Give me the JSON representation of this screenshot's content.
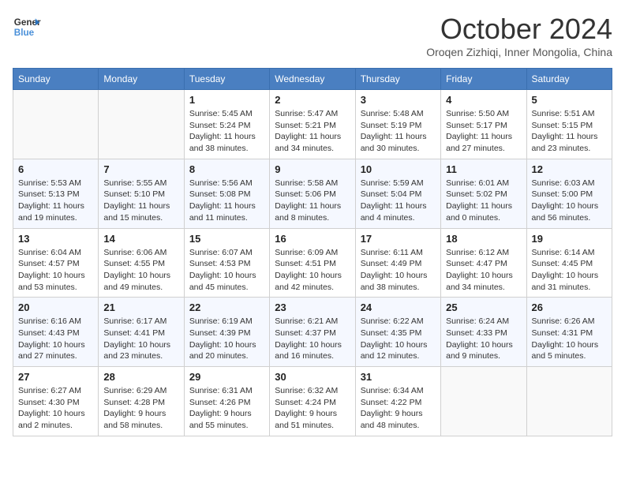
{
  "header": {
    "logo_line1": "General",
    "logo_line2": "Blue",
    "month_title": "October 2024",
    "location": "Oroqen Zizhiqi, Inner Mongolia, China"
  },
  "weekdays": [
    "Sunday",
    "Monday",
    "Tuesday",
    "Wednesday",
    "Thursday",
    "Friday",
    "Saturday"
  ],
  "weeks": [
    [
      {
        "day": "",
        "sunrise": "",
        "sunset": "",
        "daylight": ""
      },
      {
        "day": "",
        "sunrise": "",
        "sunset": "",
        "daylight": ""
      },
      {
        "day": "1",
        "sunrise": "Sunrise: 5:45 AM",
        "sunset": "Sunset: 5:24 PM",
        "daylight": "Daylight: 11 hours and 38 minutes."
      },
      {
        "day": "2",
        "sunrise": "Sunrise: 5:47 AM",
        "sunset": "Sunset: 5:21 PM",
        "daylight": "Daylight: 11 hours and 34 minutes."
      },
      {
        "day": "3",
        "sunrise": "Sunrise: 5:48 AM",
        "sunset": "Sunset: 5:19 PM",
        "daylight": "Daylight: 11 hours and 30 minutes."
      },
      {
        "day": "4",
        "sunrise": "Sunrise: 5:50 AM",
        "sunset": "Sunset: 5:17 PM",
        "daylight": "Daylight: 11 hours and 27 minutes."
      },
      {
        "day": "5",
        "sunrise": "Sunrise: 5:51 AM",
        "sunset": "Sunset: 5:15 PM",
        "daylight": "Daylight: 11 hours and 23 minutes."
      }
    ],
    [
      {
        "day": "6",
        "sunrise": "Sunrise: 5:53 AM",
        "sunset": "Sunset: 5:13 PM",
        "daylight": "Daylight: 11 hours and 19 minutes."
      },
      {
        "day": "7",
        "sunrise": "Sunrise: 5:55 AM",
        "sunset": "Sunset: 5:10 PM",
        "daylight": "Daylight: 11 hours and 15 minutes."
      },
      {
        "day": "8",
        "sunrise": "Sunrise: 5:56 AM",
        "sunset": "Sunset: 5:08 PM",
        "daylight": "Daylight: 11 hours and 11 minutes."
      },
      {
        "day": "9",
        "sunrise": "Sunrise: 5:58 AM",
        "sunset": "Sunset: 5:06 PM",
        "daylight": "Daylight: 11 hours and 8 minutes."
      },
      {
        "day": "10",
        "sunrise": "Sunrise: 5:59 AM",
        "sunset": "Sunset: 5:04 PM",
        "daylight": "Daylight: 11 hours and 4 minutes."
      },
      {
        "day": "11",
        "sunrise": "Sunrise: 6:01 AM",
        "sunset": "Sunset: 5:02 PM",
        "daylight": "Daylight: 11 hours and 0 minutes."
      },
      {
        "day": "12",
        "sunrise": "Sunrise: 6:03 AM",
        "sunset": "Sunset: 5:00 PM",
        "daylight": "Daylight: 10 hours and 56 minutes."
      }
    ],
    [
      {
        "day": "13",
        "sunrise": "Sunrise: 6:04 AM",
        "sunset": "Sunset: 4:57 PM",
        "daylight": "Daylight: 10 hours and 53 minutes."
      },
      {
        "day": "14",
        "sunrise": "Sunrise: 6:06 AM",
        "sunset": "Sunset: 4:55 PM",
        "daylight": "Daylight: 10 hours and 49 minutes."
      },
      {
        "day": "15",
        "sunrise": "Sunrise: 6:07 AM",
        "sunset": "Sunset: 4:53 PM",
        "daylight": "Daylight: 10 hours and 45 minutes."
      },
      {
        "day": "16",
        "sunrise": "Sunrise: 6:09 AM",
        "sunset": "Sunset: 4:51 PM",
        "daylight": "Daylight: 10 hours and 42 minutes."
      },
      {
        "day": "17",
        "sunrise": "Sunrise: 6:11 AM",
        "sunset": "Sunset: 4:49 PM",
        "daylight": "Daylight: 10 hours and 38 minutes."
      },
      {
        "day": "18",
        "sunrise": "Sunrise: 6:12 AM",
        "sunset": "Sunset: 4:47 PM",
        "daylight": "Daylight: 10 hours and 34 minutes."
      },
      {
        "day": "19",
        "sunrise": "Sunrise: 6:14 AM",
        "sunset": "Sunset: 4:45 PM",
        "daylight": "Daylight: 10 hours and 31 minutes."
      }
    ],
    [
      {
        "day": "20",
        "sunrise": "Sunrise: 6:16 AM",
        "sunset": "Sunset: 4:43 PM",
        "daylight": "Daylight: 10 hours and 27 minutes."
      },
      {
        "day": "21",
        "sunrise": "Sunrise: 6:17 AM",
        "sunset": "Sunset: 4:41 PM",
        "daylight": "Daylight: 10 hours and 23 minutes."
      },
      {
        "day": "22",
        "sunrise": "Sunrise: 6:19 AM",
        "sunset": "Sunset: 4:39 PM",
        "daylight": "Daylight: 10 hours and 20 minutes."
      },
      {
        "day": "23",
        "sunrise": "Sunrise: 6:21 AM",
        "sunset": "Sunset: 4:37 PM",
        "daylight": "Daylight: 10 hours and 16 minutes."
      },
      {
        "day": "24",
        "sunrise": "Sunrise: 6:22 AM",
        "sunset": "Sunset: 4:35 PM",
        "daylight": "Daylight: 10 hours and 12 minutes."
      },
      {
        "day": "25",
        "sunrise": "Sunrise: 6:24 AM",
        "sunset": "Sunset: 4:33 PM",
        "daylight": "Daylight: 10 hours and 9 minutes."
      },
      {
        "day": "26",
        "sunrise": "Sunrise: 6:26 AM",
        "sunset": "Sunset: 4:31 PM",
        "daylight": "Daylight: 10 hours and 5 minutes."
      }
    ],
    [
      {
        "day": "27",
        "sunrise": "Sunrise: 6:27 AM",
        "sunset": "Sunset: 4:30 PM",
        "daylight": "Daylight: 10 hours and 2 minutes."
      },
      {
        "day": "28",
        "sunrise": "Sunrise: 6:29 AM",
        "sunset": "Sunset: 4:28 PM",
        "daylight": "Daylight: 9 hours and 58 minutes."
      },
      {
        "day": "29",
        "sunrise": "Sunrise: 6:31 AM",
        "sunset": "Sunset: 4:26 PM",
        "daylight": "Daylight: 9 hours and 55 minutes."
      },
      {
        "day": "30",
        "sunrise": "Sunrise: 6:32 AM",
        "sunset": "Sunset: 4:24 PM",
        "daylight": "Daylight: 9 hours and 51 minutes."
      },
      {
        "day": "31",
        "sunrise": "Sunrise: 6:34 AM",
        "sunset": "Sunset: 4:22 PM",
        "daylight": "Daylight: 9 hours and 48 minutes."
      },
      {
        "day": "",
        "sunrise": "",
        "sunset": "",
        "daylight": ""
      },
      {
        "day": "",
        "sunrise": "",
        "sunset": "",
        "daylight": ""
      }
    ]
  ]
}
